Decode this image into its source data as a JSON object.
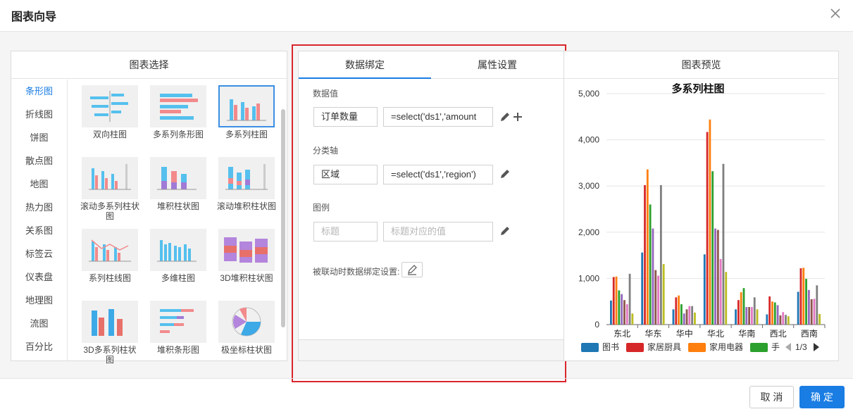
{
  "dialog": {
    "title": "图表向导"
  },
  "chart_select": {
    "header": "图表选择",
    "types": [
      "条形图",
      "折线图",
      "饼图",
      "散点图",
      "地图",
      "热力图",
      "关系图",
      "标签云",
      "仪表盘",
      "地理图",
      "流图",
      "百分比"
    ],
    "active_type": "条形图",
    "thumbs": [
      {
        "label": "双向柱图",
        "icon": "bidirectional-bar-chart-icon"
      },
      {
        "label": "多系列条形图",
        "icon": "multi-series-bar-icon"
      },
      {
        "label": "多系列柱图",
        "icon": "multi-series-column-icon",
        "selected": true
      },
      {
        "label": "滚动多系列柱状图",
        "icon": "scroll-multi-column-icon"
      },
      {
        "label": "堆积柱状图",
        "icon": "stacked-column-icon"
      },
      {
        "label": "滚动堆积柱状图",
        "icon": "scroll-stacked-column-icon"
      },
      {
        "label": "系列柱线图",
        "icon": "column-line-icon"
      },
      {
        "label": "多维柱图",
        "icon": "multi-dimension-column-icon"
      },
      {
        "label": "3D堆积柱状图",
        "icon": "3d-stacked-column-icon"
      },
      {
        "label": "3D多系列柱状图",
        "icon": "3d-multi-column-icon"
      },
      {
        "label": "堆积条形图",
        "icon": "stacked-bar-icon"
      },
      {
        "label": "极坐标柱状图",
        "icon": "polar-column-icon"
      }
    ]
  },
  "binding": {
    "tabs": [
      "数据绑定",
      "属性设置"
    ],
    "active_tab": "数据绑定",
    "value_section": "数据值",
    "value_field": "订单数量",
    "value_expr": "=select('ds1','amount",
    "category_section": "分类轴",
    "category_field": "区域",
    "category_expr": "=select('ds1','region')",
    "legend_section": "图例",
    "legend_title_placeholder": "标题",
    "legend_value_placeholder": "标题对应的值",
    "linked_label": "被联动时数据绑定设置:"
  },
  "preview": {
    "header": "图表预览",
    "pager": "1/3"
  },
  "chart_data": {
    "type": "bar",
    "title": "多系列柱图",
    "xlabel": "",
    "ylabel": "",
    "ylim": [
      0,
      5000
    ],
    "yticks": [
      "0",
      "1,000",
      "2,000",
      "3,000",
      "4,000",
      "5,000"
    ],
    "grid": true,
    "legend_position": "bottom",
    "categories": [
      "东北",
      "华东",
      "华中",
      "华北",
      "华南",
      "西北",
      "西南"
    ],
    "series": [
      {
        "name": "图书",
        "color": "#1f77b4",
        "values": [
          520,
          1560,
          330,
          1520,
          330,
          220,
          710
        ]
      },
      {
        "name": "家居厨具",
        "color": "#d62728",
        "values": [
          1030,
          3020,
          590,
          4170,
          530,
          610,
          1220
        ]
      },
      {
        "name": "家用电器",
        "color": "#ff7f0e",
        "values": [
          1040,
          3360,
          630,
          4440,
          700,
          500,
          1230
        ]
      },
      {
        "name": "手",
        "color": "#2ca02c",
        "values": [
          740,
          2600,
          440,
          3320,
          790,
          480,
          990
        ]
      },
      {
        "color": "#9467bd",
        "values": [
          660,
          2080,
          240,
          2080,
          380,
          420,
          750
        ]
      },
      {
        "color": "#8c564b",
        "values": [
          530,
          1180,
          330,
          2050,
          380,
          200,
          550
        ]
      },
      {
        "color": "#e377c2",
        "values": [
          440,
          1060,
          400,
          1420,
          380,
          270,
          560
        ]
      },
      {
        "color": "#7f7f7f",
        "values": [
          1100,
          3020,
          400,
          3480,
          590,
          210,
          850
        ]
      },
      {
        "color": "#bcbd22",
        "values": [
          240,
          1310,
          260,
          1140,
          330,
          180,
          230
        ]
      }
    ]
  },
  "footer": {
    "cancel": "取 消",
    "ok": "确 定"
  }
}
